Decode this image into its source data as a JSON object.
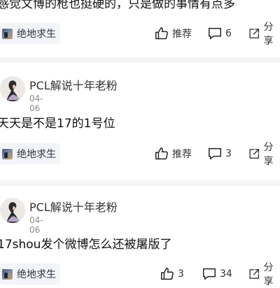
{
  "posts": [
    {
      "content": "感觉文博的枪也挺硬的，只是做的事情有点多",
      "tag": "绝地求生",
      "actions": {
        "like": "推荐",
        "comments": "6",
        "share": "分享"
      }
    },
    {
      "author": "PCL解说十年老粉",
      "date": "04-06",
      "content": "天天是不是17的1号位",
      "tag": "绝地求生",
      "actions": {
        "like": "推荐",
        "comments": "3",
        "share": "分享"
      }
    },
    {
      "author": "PCL解说十年老粉",
      "date": "04-06",
      "content": "17shou发个微博怎么还被屠版了",
      "tag": "绝地求生",
      "actions": {
        "like": "3",
        "comments": "34",
        "share": "分享"
      }
    }
  ]
}
